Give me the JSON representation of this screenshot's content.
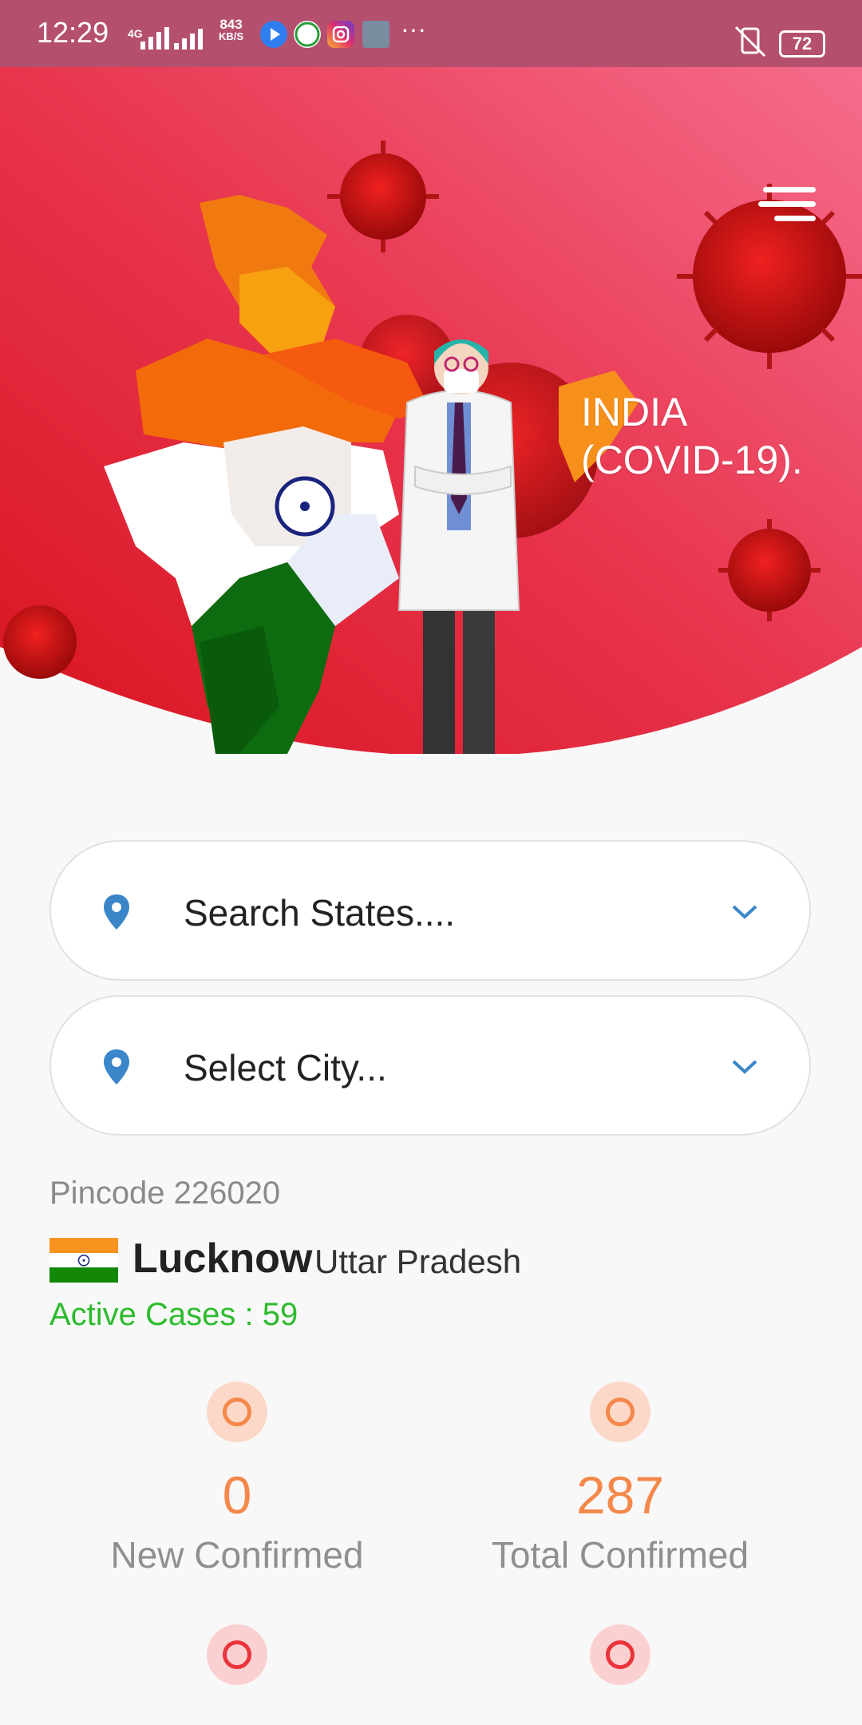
{
  "status_bar": {
    "time": "12:29",
    "network": "4G",
    "speed_value": "843",
    "speed_unit": "KB/S",
    "overflow": "···",
    "battery": "72"
  },
  "hero": {
    "title_line1": "INDIA",
    "title_line2": "(COVID-19).",
    "menu_icon": "hamburger-menu-icon",
    "colors": {
      "top": "#f0607a",
      "bottom": "#e01a2a"
    }
  },
  "search": {
    "states_placeholder": "Search States....",
    "city_placeholder": "Select City...",
    "pin_icon": "location-pin-icon",
    "chevron_icon": "chevron-down-icon",
    "accent": "#3a86c8"
  },
  "location": {
    "pincode_label": "Pincode 226020",
    "city": "Lucknow",
    "state": "Uttar Pradesh",
    "active_cases": "Active Cases : 59"
  },
  "stats": [
    {
      "value": "0",
      "label": "New Confirmed",
      "color": "#f4884a"
    },
    {
      "value": "287",
      "label": "Total Confirmed",
      "color": "#f4884a"
    }
  ]
}
